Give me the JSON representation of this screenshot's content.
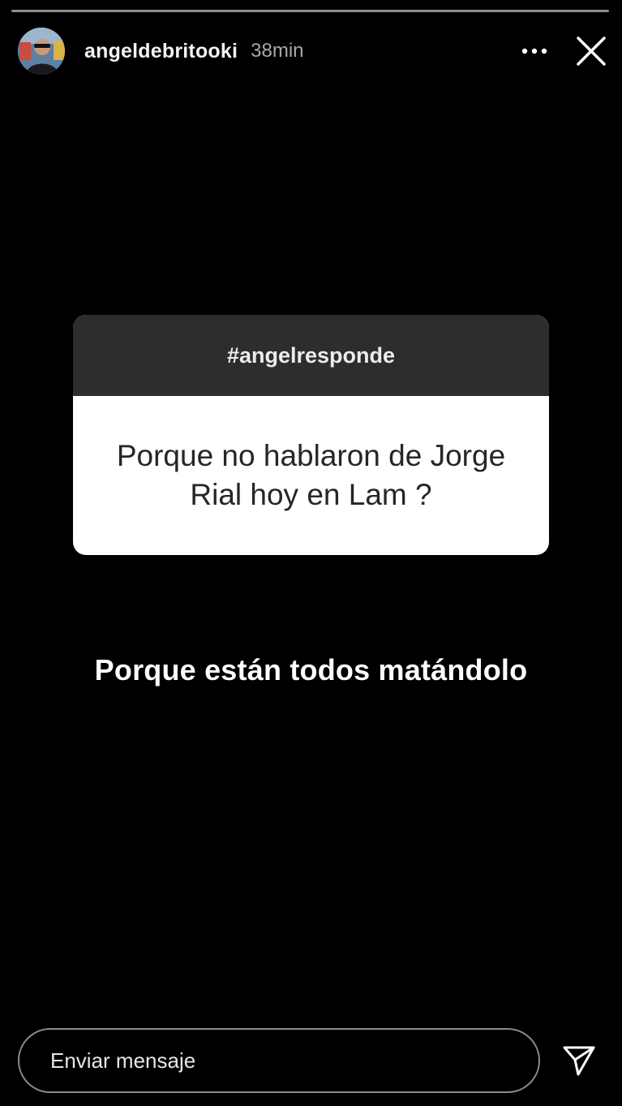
{
  "story": {
    "progress_segments": 1,
    "username": "angeldebritooki",
    "time_ago": "38min"
  },
  "question_sticker": {
    "header": "#angelresponde",
    "question": "Porque no hablaron de Jorge Rial hoy en Lam ?"
  },
  "answer": {
    "text": "Porque están todos matándolo"
  },
  "footer": {
    "message_placeholder": "Enviar mensaje"
  },
  "icons": {
    "more": "more-options-icon",
    "close": "close-icon",
    "send": "send-icon"
  },
  "colors": {
    "background": "#000000",
    "sticker_header": "#2d2d2d",
    "sticker_body": "#ffffff",
    "question_text": "#262626"
  }
}
